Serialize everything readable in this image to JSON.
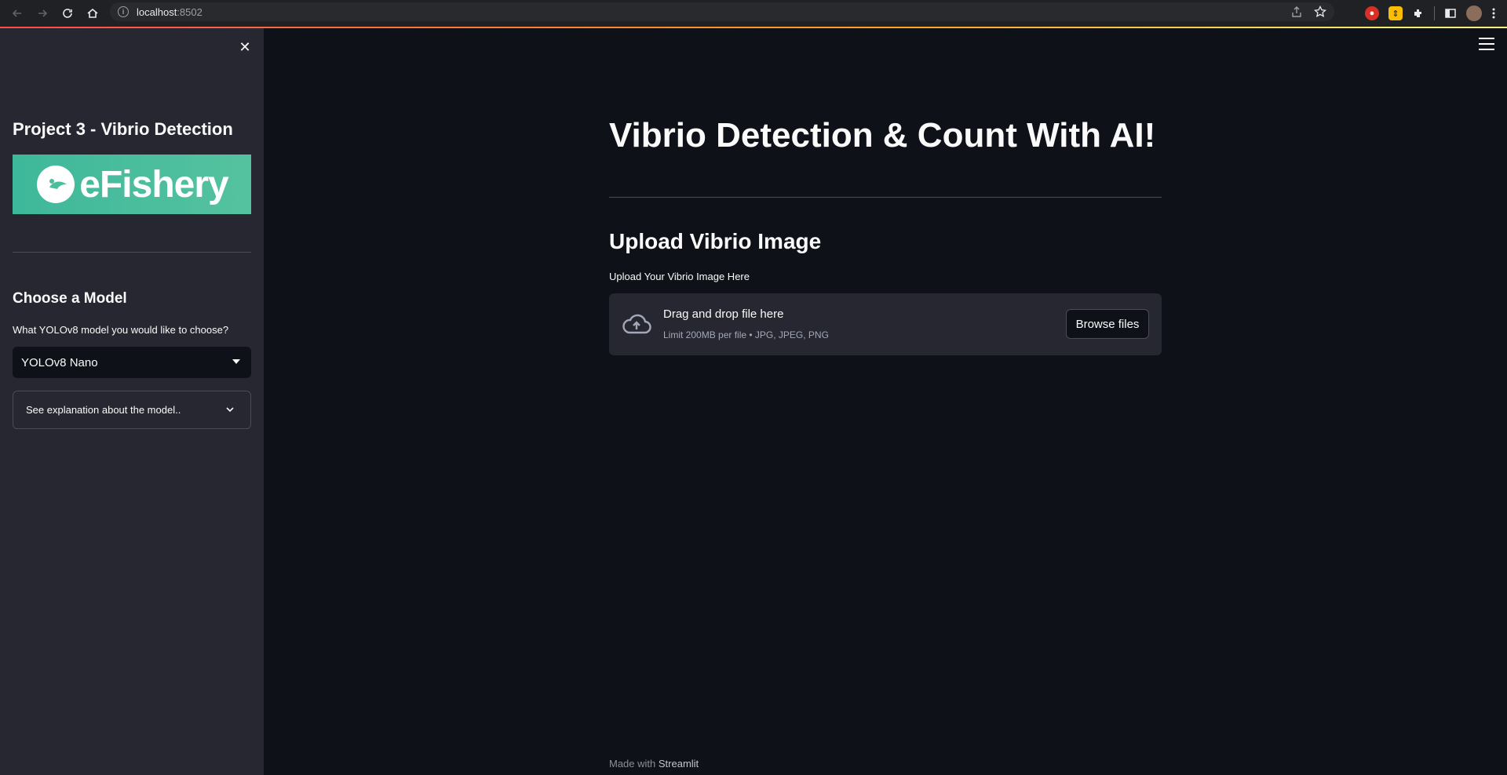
{
  "browser": {
    "url_host": "localhost",
    "url_port": ":8502"
  },
  "sidebar": {
    "title": "Project 3 - Vibrio Detection",
    "logo_text": "eFishery",
    "section_heading": "Choose a Model",
    "select_label": "What YOLOv8 model you would like to choose?",
    "select_value": "YOLOv8 Nano",
    "expander_label": "See explanation about the model.."
  },
  "main": {
    "title": "Vibrio Detection & Count With AI!",
    "upload_heading": "Upload Vibrio Image",
    "upload_label": "Upload Your Vibrio Image Here",
    "dropzone_title": "Drag and drop file here",
    "dropzone_subtitle": "Limit 200MB per file • JPG, JPEG, PNG",
    "browse_button": "Browse files"
  },
  "footer": {
    "made_with": "Made with",
    "brand": "Streamlit"
  },
  "colors": {
    "background": "#0e1117",
    "sidebar": "#262730",
    "logo_bg": "#4bbd9d"
  }
}
